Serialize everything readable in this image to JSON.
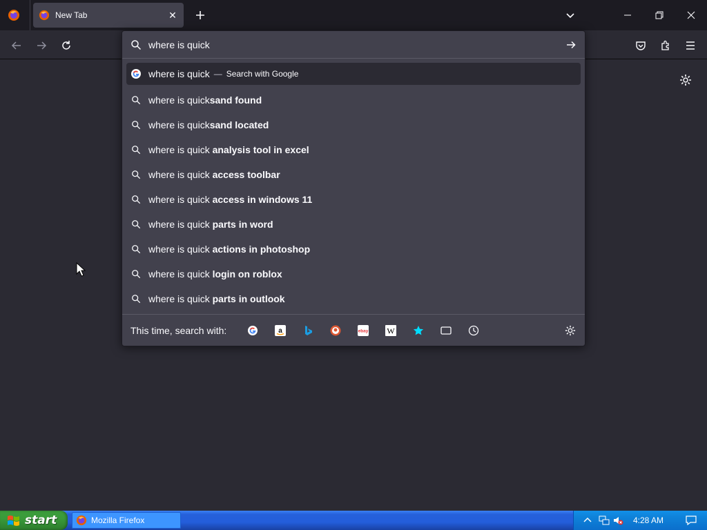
{
  "tab": {
    "title": "New Tab",
    "close_glyph": "✕"
  },
  "window_buttons": {
    "minimize": "minimize-icon",
    "restore": "restore-icon",
    "close": "close-icon"
  },
  "urlbar": {
    "query": "where is quick"
  },
  "results": [
    {
      "typed": "where is quick",
      "suffix": "",
      "separator": "—",
      "action": "Search with Google",
      "icon": "google-icon",
      "selected": true
    },
    {
      "typed": "where is quick",
      "suffix": "sand found",
      "icon": "search-icon"
    },
    {
      "typed": "where is quick",
      "suffix": "sand located",
      "icon": "search-icon"
    },
    {
      "typed": "where is quick ",
      "suffix": "analysis tool in excel",
      "icon": "search-icon"
    },
    {
      "typed": "where is quick ",
      "suffix": "access toolbar",
      "icon": "search-icon"
    },
    {
      "typed": "where is quick ",
      "suffix": "access in windows 11",
      "icon": "search-icon"
    },
    {
      "typed": "where is quick ",
      "suffix": "parts in word",
      "icon": "search-icon"
    },
    {
      "typed": "where is quick ",
      "suffix": "actions in photoshop",
      "icon": "search-icon"
    },
    {
      "typed": "where is quick ",
      "suffix": "login on roblox",
      "icon": "search-icon"
    },
    {
      "typed": "where is quick ",
      "suffix": "parts in outlook",
      "icon": "search-icon"
    }
  ],
  "oneoff": {
    "label": "This time, search with:",
    "engines": [
      "google-icon",
      "amazon-icon",
      "bing-icon",
      "duckduckgo-icon",
      "ebay-icon",
      "wikipedia-icon",
      "bookmarks-star-icon",
      "tabs-icon",
      "history-icon"
    ]
  },
  "taskbar": {
    "start_label": "start",
    "task_label": "Mozilla Firefox",
    "clock": "4:28 AM"
  },
  "colors": {
    "toolbar": "#2b2a33",
    "tabstrip": "#1c1b22",
    "popup": "#42414d",
    "text": "#fbfbfe",
    "xp_blue": "#245edb",
    "xp_green": "#3a9a3a"
  }
}
